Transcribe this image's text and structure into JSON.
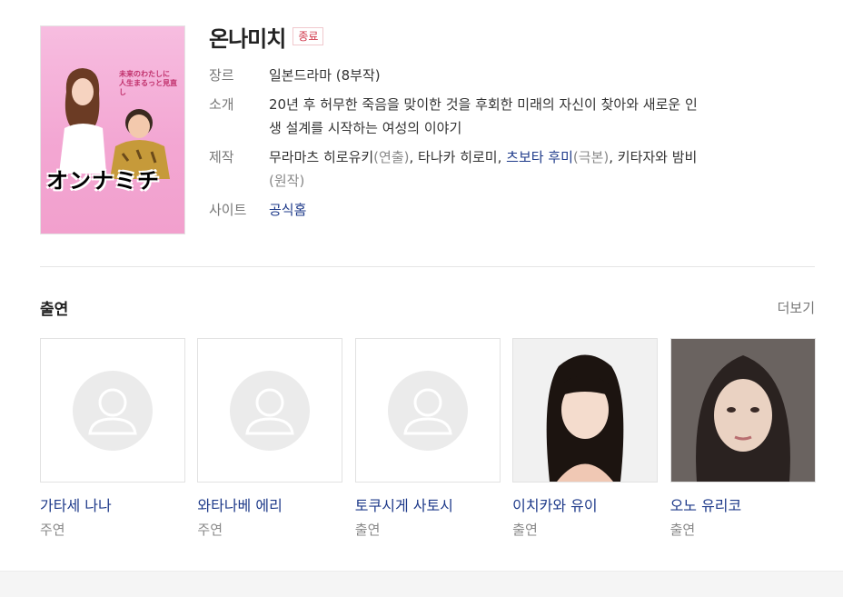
{
  "poster": {
    "text_line1": "未来のわたしに",
    "text_line2": "人生まるっと見直し",
    "logo_text": "オンナミチ",
    "bg_color": "#f3a7d3"
  },
  "title": "온나미치",
  "status_badge": "종료",
  "info": {
    "genre_label": "장르",
    "genre_value": "일본드라마 (8부작)",
    "intro_label": "소개",
    "intro_line1": "20년 후 허무한 죽음을 맞이한 것을 후회한 미래의 자신이 찾아와 새로운 인",
    "intro_line2": "생 설계를 시작하는 여성의 이야기",
    "production_label": "제작",
    "production": {
      "part1": "무라마츠 히로유키",
      "part1_role": "(연출)",
      "sep1": ", 타나카 히로미, ",
      "part2": "츠보타 후미",
      "part2_role": "(극본)",
      "sep2": ", 키타자와 밤비",
      "part3_role": "(원작)"
    },
    "site_label": "사이트",
    "site_value": "공식홈"
  },
  "cast": {
    "title": "출연",
    "more_label": "더보기",
    "members": [
      {
        "name": "가타세 나나",
        "role": "주연",
        "photo": "placeholder-avatar-icon"
      },
      {
        "name": "와타나베 에리",
        "role": "주연",
        "photo": "placeholder-avatar-icon"
      },
      {
        "name": "토쿠시게 사토시",
        "role": "출연",
        "photo": "placeholder-avatar-icon"
      },
      {
        "name": "이치카와 유이",
        "role": "출연",
        "photo": "portrait"
      },
      {
        "name": "오노 유리코",
        "role": "출연",
        "photo": "portrait"
      }
    ]
  },
  "colors": {
    "link": "#1e3a8a",
    "badge": "#d0384b",
    "muted": "#888888"
  }
}
